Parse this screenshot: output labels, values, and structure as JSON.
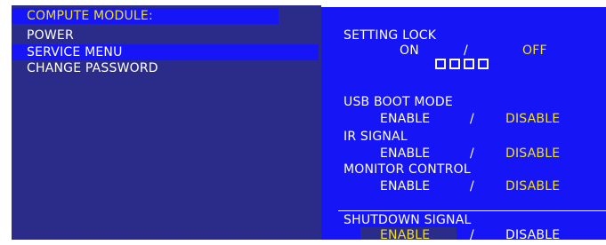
{
  "menu": {
    "header": "COMPUTE MODULE:",
    "items": [
      {
        "label": "POWER",
        "selected": false
      },
      {
        "label": "SERVICE MENU",
        "selected": true
      },
      {
        "label": "CHANGE PASSWORD",
        "selected": false
      }
    ]
  },
  "settings": {
    "setting_lock": {
      "label": "SETTING LOCK",
      "on": "ON",
      "sep": "/",
      "off": "OFF",
      "selected": "OFF",
      "password_digits": 4
    },
    "usb_boot_mode": {
      "label": "USB BOOT MODE",
      "enable": "ENABLE",
      "sep": "/",
      "disable": "DISABLE",
      "selected": "DISABLE"
    },
    "ir_signal": {
      "label": "IR SIGNAL",
      "enable": "ENABLE",
      "sep": "/",
      "disable": "DISABLE",
      "selected": "DISABLE"
    },
    "monitor_control": {
      "label": "MONITOR CONTROL",
      "enable": "ENABLE",
      "sep": "/",
      "disable": "DISABLE",
      "selected": "DISABLE"
    },
    "shutdown_signal": {
      "label": "SHUTDOWN SIGNAL",
      "enable": "ENABLE",
      "sep": "/",
      "disable": "DISABLE",
      "selected": "ENABLE"
    }
  },
  "colors": {
    "osd_blue": "#1515f5",
    "panel_navy": "#2b2b8a",
    "highlight_yellow": "#f0e020",
    "text_white": "#ffffff"
  }
}
